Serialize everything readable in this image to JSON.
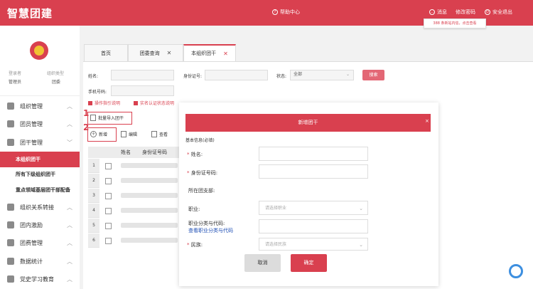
{
  "header": {
    "logo": "智慧团建",
    "help": "帮助中心",
    "message": "消息",
    "change_password": "修改密码",
    "logout": "安全退出",
    "tooltip": "388 条新站内信，点击查看"
  },
  "sidebar": {
    "login_label": "登录者",
    "login_value": "管理员",
    "org_type_label": "组织类型",
    "org_type_value": "团委",
    "menu": [
      {
        "label": "组织管理"
      },
      {
        "label": "团员管理"
      },
      {
        "label": "团干管理"
      }
    ],
    "submenu": [
      {
        "label": "本组织团干"
      },
      {
        "label": "所有下级组织团干"
      },
      {
        "label": "重点领域基层团干部配备"
      }
    ],
    "menu2": [
      {
        "label": "组织关系转接"
      },
      {
        "label": "团内激励"
      },
      {
        "label": "团费管理"
      },
      {
        "label": "数据统计"
      },
      {
        "label": "党史学习教育"
      }
    ]
  },
  "tabs": [
    {
      "label": "首页"
    },
    {
      "label": "团委查询",
      "close": "✕"
    },
    {
      "label": "本组织团干",
      "close": "✕"
    }
  ],
  "filters": {
    "name_label": "姓名:",
    "id_label": "身份证号:",
    "status_label": "状态:",
    "status_value": "全部",
    "phone_label": "手机号码:",
    "search": "搜索"
  },
  "links": {
    "operation_guide": "操作指引说明",
    "realname_explain": "实名认证状态说明"
  },
  "toolbar": {
    "batch_import": "批量导入团干",
    "add": "新增",
    "edit": "编辑",
    "view": "查看",
    "step1": "1",
    "step2": "2"
  },
  "table": {
    "columns": [
      "姓名",
      "身份证号码"
    ],
    "rows": [
      "1",
      "2",
      "3",
      "4",
      "5",
      "6"
    ]
  },
  "modal": {
    "title": "新增团干",
    "close": "×",
    "section": "基本信息(必填)",
    "name_label": "姓名:",
    "id_label": "身份证号码:",
    "branch_label": "所在团支部:",
    "job_label": "职业:",
    "job_placeholder": "请选择职业",
    "job_class_label": "职业分类与代码:",
    "job_class_link": "查看职业分类与代码",
    "ethnic_label": "民族:",
    "ethnic_placeholder": "请选择民族",
    "cancel": "取消",
    "ok": "确定"
  },
  "colors": {
    "brand": "#d9404f"
  }
}
